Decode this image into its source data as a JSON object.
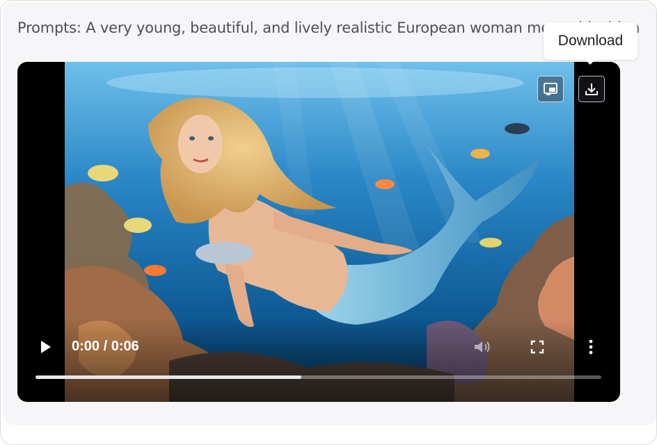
{
  "prompt": {
    "text": "Prompts: A very young, beautiful, and lively realistic European woman mermaid with a"
  },
  "player": {
    "current_time": "0:00",
    "duration": "0:06",
    "time_display": "0:00 / 0:06",
    "progress_fraction": 0.47,
    "image_subject": "mermaid swimming underwater among coral reef and tropical fish"
  },
  "overlay": {
    "buttons": [
      {
        "name": "picture-in-picture-icon"
      },
      {
        "name": "download-icon"
      }
    ]
  },
  "tooltip": {
    "label": "Download"
  },
  "controls": {
    "icons": [
      "play-icon",
      "volume-icon",
      "fullscreen-icon",
      "more-options-icon"
    ]
  },
  "colors": {
    "panel_bg": "#f6f6f8",
    "prompt_text": "#4e4e57",
    "player_bg": "#000000",
    "water_deep": "#0b4f86",
    "water_light": "#5fb3e0"
  }
}
